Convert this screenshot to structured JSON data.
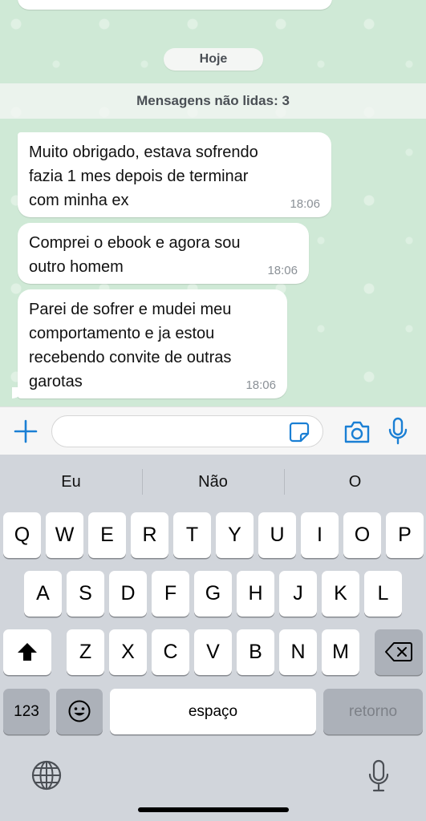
{
  "chat": {
    "date_pill": "Hoje",
    "unread_banner": "Mensagens não lidas: 3",
    "messages": [
      {
        "text": "Muito obrigado, estava sofrendo\nfazia 1 mes depois de terminar\ncom minha ex",
        "time": "18:06"
      },
      {
        "text": "Comprei o ebook e agora sou\noutro homem",
        "time": "18:06"
      },
      {
        "text": "Parei de sofrer e mudei meu\ncomportamento e ja estou\nrecebendo convite de outras\ngarotas",
        "time": "18:06"
      }
    ]
  },
  "input_bar": {
    "message_value": "",
    "icons": [
      "plus-icon",
      "sticker-icon",
      "camera-icon",
      "microphone-icon"
    ],
    "accent_color": "#1a7fd4"
  },
  "keyboard": {
    "suggestions": [
      "Eu",
      "Não",
      "O"
    ],
    "row1": [
      "Q",
      "W",
      "E",
      "R",
      "T",
      "Y",
      "U",
      "I",
      "O",
      "P"
    ],
    "row2": [
      "A",
      "S",
      "D",
      "F",
      "G",
      "H",
      "J",
      "K",
      "L"
    ],
    "row3": [
      "Z",
      "X",
      "C",
      "V",
      "B",
      "N",
      "M"
    ],
    "numbers_key": "123",
    "space_key": "espaço",
    "return_key": "retorno",
    "icons": [
      "shift-icon",
      "backspace-icon",
      "emoji-icon",
      "globe-icon",
      "dictation-mic-icon"
    ]
  }
}
